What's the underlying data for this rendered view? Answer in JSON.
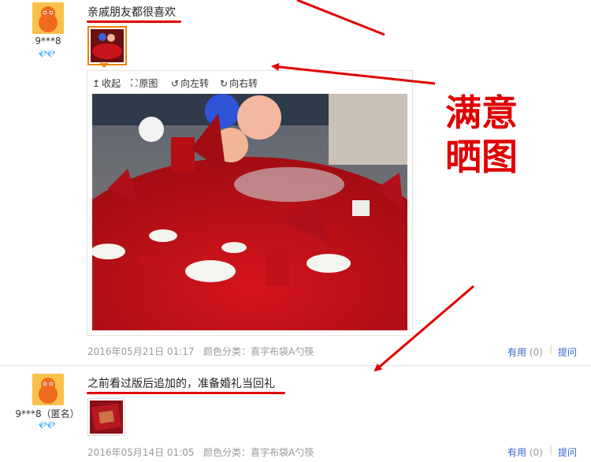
{
  "reviews": [
    {
      "username": "9***8",
      "gems": "💎💎",
      "comment": "亲戚朋友都很喜欢",
      "date": "2016年05月21日 01:17",
      "sku": "颜色分类：喜字布袋A勺筷",
      "useful_label": "有用",
      "useful_count": "(0)",
      "reply_label": "提问"
    },
    {
      "username": "9***8（匿名）",
      "gems": "💎💎",
      "comment": "之前看过版后追加的，准备婚礼当回礼",
      "date": "2016年05月14日 01:05",
      "sku": "颜色分类：喜字布袋A勺筷",
      "useful_label": "有用",
      "useful_count": "(0)",
      "reply_label": "提问"
    }
  ],
  "viewer": {
    "collapse_label": "收起",
    "original_label": "原图",
    "rotate_left_label": "向左转",
    "rotate_right_label": "向右转"
  },
  "annotation": {
    "line1": "满意",
    "line2": "晒图"
  },
  "colors": {
    "accent_red": "#e00000",
    "link_blue": "#3366cc",
    "thumb_border": "#f08300"
  }
}
